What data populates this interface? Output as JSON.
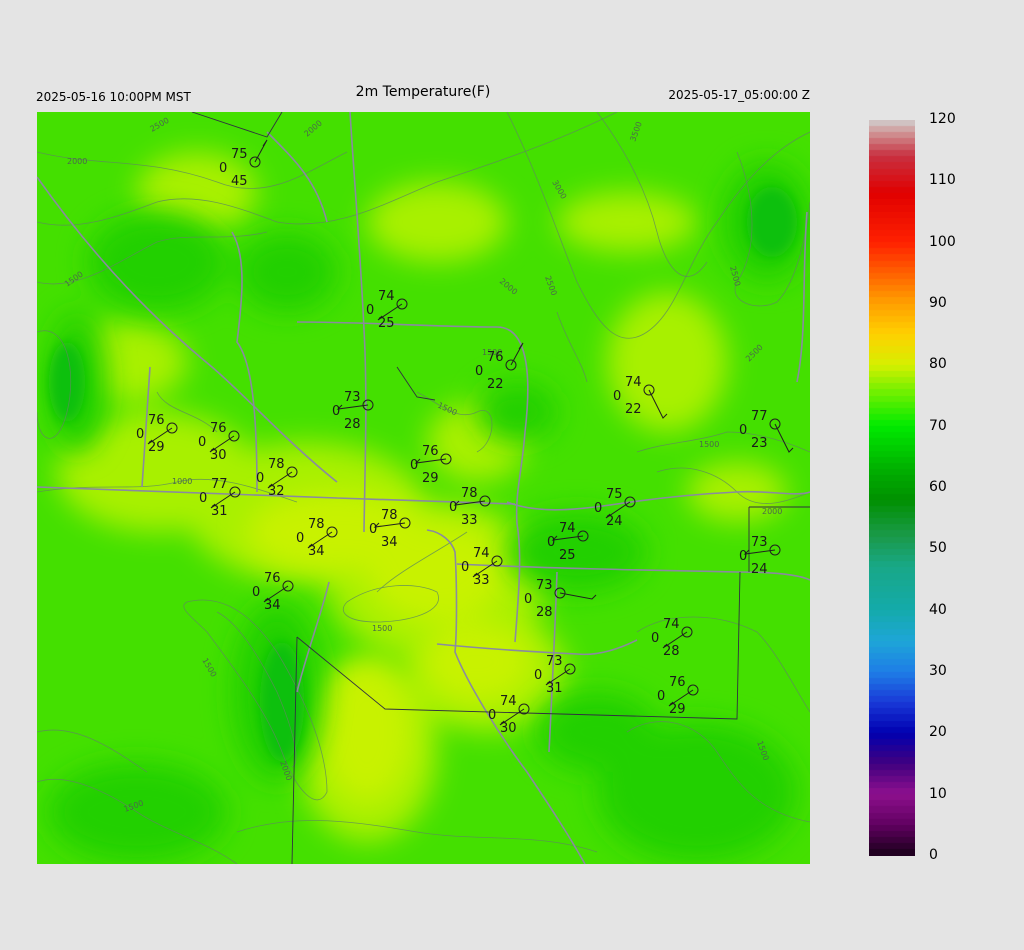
{
  "header": {
    "left": "2025-05-16 10:00PM MST",
    "center": "2m Temperature(F)",
    "right": "2025-05-17_05:00:00 Z"
  },
  "colorbar": {
    "labels": [
      "120",
      "110",
      "100",
      "90",
      "80",
      "70",
      "60",
      "50",
      "40",
      "30",
      "20",
      "10",
      "0"
    ],
    "min": 0,
    "max": 120,
    "stops": [
      {
        "v": 0,
        "c": "#1a001a"
      },
      {
        "v": 5,
        "c": "#600060"
      },
      {
        "v": 10,
        "c": "#8e108e"
      },
      {
        "v": 15,
        "c": "#400080"
      },
      {
        "v": 20,
        "c": "#0000b0"
      },
      {
        "v": 25,
        "c": "#1a3ad8"
      },
      {
        "v": 30,
        "c": "#1e7ee6"
      },
      {
        "v": 35,
        "c": "#1ea6d8"
      },
      {
        "v": 40,
        "c": "#14aaaa"
      },
      {
        "v": 47,
        "c": "#18a888"
      },
      {
        "v": 52,
        "c": "#1a9a4a"
      },
      {
        "v": 58,
        "c": "#009000"
      },
      {
        "v": 63,
        "c": "#00b000"
      },
      {
        "v": 70,
        "c": "#00ea00"
      },
      {
        "v": 76,
        "c": "#7af000"
      },
      {
        "v": 80,
        "c": "#d6f000"
      },
      {
        "v": 85,
        "c": "#ffd000"
      },
      {
        "v": 90,
        "c": "#ffa000"
      },
      {
        "v": 95,
        "c": "#ff6000"
      },
      {
        "v": 100,
        "c": "#ff2000"
      },
      {
        "v": 108,
        "c": "#e00000"
      },
      {
        "v": 114,
        "c": "#c83040"
      },
      {
        "v": 118,
        "c": "#d09898"
      },
      {
        "v": 120,
        "c": "#d0d0d0"
      }
    ]
  },
  "contour_labels": [
    "2500",
    "2000",
    "2000",
    "3000",
    "3500",
    "1500",
    "2000",
    "2500",
    "2500",
    "1500",
    "2500",
    "1500",
    "1000",
    "1500",
    "2000",
    "1500",
    "1500",
    "2000",
    "1500",
    "1500"
  ],
  "stations": [
    {
      "t": "75",
      "d": "45",
      "w": "0"
    },
    {
      "t": "74",
      "d": "25",
      "w": "0"
    },
    {
      "t": "76",
      "d": "22",
      "w": "0"
    },
    {
      "t": "74",
      "d": "22",
      "w": "0"
    },
    {
      "t": "73",
      "d": "28",
      "w": "0"
    },
    {
      "t": "76",
      "d": "29",
      "w": "0"
    },
    {
      "t": "76",
      "d": "30",
      "w": "0"
    },
    {
      "t": "77",
      "d": "23",
      "w": "0"
    },
    {
      "t": "76",
      "d": "29",
      "w": "0"
    },
    {
      "t": "78",
      "d": "32",
      "w": "0"
    },
    {
      "t": "77",
      "d": "31",
      "w": "0"
    },
    {
      "t": "78",
      "d": "33",
      "w": "0"
    },
    {
      "t": "75",
      "d": "24",
      "w": "0"
    },
    {
      "t": "78",
      "d": "34",
      "w": "0"
    },
    {
      "t": "78",
      "d": "34",
      "w": "0"
    },
    {
      "t": "74",
      "d": "25",
      "w": "0"
    },
    {
      "t": "73",
      "d": "24",
      "w": "0"
    },
    {
      "t": "74",
      "d": "33",
      "w": "0"
    },
    {
      "t": "76",
      "d": "34",
      "w": "0"
    },
    {
      "t": "73",
      "d": "28",
      "w": "0"
    },
    {
      "t": "74",
      "d": "28",
      "w": "0"
    },
    {
      "t": "73",
      "d": "31",
      "w": "0"
    },
    {
      "t": "76",
      "d": "29",
      "w": "0"
    },
    {
      "t": "74",
      "d": "30",
      "w": "0"
    }
  ]
}
